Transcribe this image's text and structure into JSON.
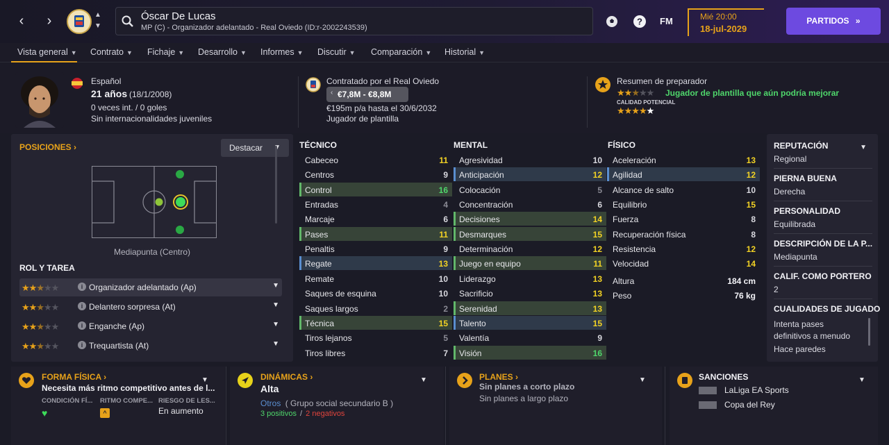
{
  "header": {
    "player_name": "Óscar De Lucas",
    "player_sub": "MP (C) - Organizador adelantado - Real Oviedo (ID:r-2002243539)",
    "date_day": "Mié 20:00",
    "date_value": "18-jul-2029",
    "fm_label": "FM",
    "continue_label": "PARTIDOS",
    "accent": "#e7a21a",
    "continue_color": "#6d4ae0"
  },
  "tabs": [
    {
      "label": "Vista general"
    },
    {
      "label": "Contrato"
    },
    {
      "label": "Fichaje"
    },
    {
      "label": "Desarrollo"
    },
    {
      "label": "Informes"
    },
    {
      "label": "Discutir"
    },
    {
      "label": "Comparación"
    },
    {
      "label": "Historial"
    }
  ],
  "profile": {
    "nationality": "Español",
    "age": "21 años",
    "birth": "(18/1/2008)",
    "caps": "0 veces int. / 0 goles",
    "youth_caps": "Sin internacionalidades juveniles",
    "contracted_by": "Contratado por el Real Oviedo",
    "value": "€7,8M - €8,8M",
    "wage": "€195m p/a hasta el 30/6/2032",
    "squad_status": "Jugador de plantilla",
    "coach_report_title": "Resumen de preparador",
    "coach_report_text": "Jugador de plantilla que aún podría mejorar",
    "current_ability_stars": 2.5,
    "potential_label": "CALIDAD POTENCIAL",
    "potential_stars": 4.5
  },
  "positions": {
    "title": "POSICIONES",
    "highlight_label": "Destacar",
    "position_label": "Mediapunta (Centro)"
  },
  "roles": {
    "title": "ROL Y TAREA",
    "items": [
      {
        "name": "Organizador adelantado (Ap)",
        "stars": 2.5
      },
      {
        "name": "Delantero sorpresa (At)",
        "stars": 2.5
      },
      {
        "name": "Enganche (Ap)",
        "stars": 2.5
      },
      {
        "name": "Trequartista (At)",
        "stars": 2.5
      }
    ]
  },
  "attributes": {
    "technical_title": "TÉCNICO",
    "mental_title": "MENTAL",
    "physical_title": "FÍSICO",
    "technical": [
      {
        "name": "Cabeceo",
        "value": "11",
        "hl": ""
      },
      {
        "name": "Centros",
        "value": "9",
        "hl": ""
      },
      {
        "name": "Control",
        "value": "16",
        "hl": "green"
      },
      {
        "name": "Entradas",
        "value": "4",
        "hl": ""
      },
      {
        "name": "Marcaje",
        "value": "6",
        "hl": ""
      },
      {
        "name": "Pases",
        "value": "11",
        "hl": "green"
      },
      {
        "name": "Penaltis",
        "value": "9",
        "hl": ""
      },
      {
        "name": "Regate",
        "value": "13",
        "hl": "blue"
      },
      {
        "name": "Remate",
        "value": "10",
        "hl": ""
      },
      {
        "name": "Saques de esquina",
        "value": "10",
        "hl": ""
      },
      {
        "name": "Saques largos",
        "value": "2",
        "hl": ""
      },
      {
        "name": "Técnica",
        "value": "15",
        "hl": "green"
      },
      {
        "name": "Tiros lejanos",
        "value": "5",
        "hl": ""
      },
      {
        "name": "Tiros libres",
        "value": "7",
        "hl": ""
      }
    ],
    "mental": [
      {
        "name": "Agresividad",
        "value": "10",
        "hl": ""
      },
      {
        "name": "Anticipación",
        "value": "12",
        "hl": "blue"
      },
      {
        "name": "Colocación",
        "value": "5",
        "hl": ""
      },
      {
        "name": "Concentración",
        "value": "6",
        "hl": ""
      },
      {
        "name": "Decisiones",
        "value": "14",
        "hl": "green"
      },
      {
        "name": "Desmarques",
        "value": "15",
        "hl": "green"
      },
      {
        "name": "Determinación",
        "value": "12",
        "hl": ""
      },
      {
        "name": "Juego en equipo",
        "value": "11",
        "hl": "green"
      },
      {
        "name": "Liderazgo",
        "value": "13",
        "hl": ""
      },
      {
        "name": "Sacrificio",
        "value": "13",
        "hl": ""
      },
      {
        "name": "Serenidad",
        "value": "13",
        "hl": "green"
      },
      {
        "name": "Talento",
        "value": "15",
        "hl": "blue"
      },
      {
        "name": "Valentía",
        "value": "9",
        "hl": ""
      },
      {
        "name": "Visión",
        "value": "16",
        "hl": "green"
      }
    ],
    "physical": [
      {
        "name": "Aceleración",
        "value": "13",
        "hl": ""
      },
      {
        "name": "Agilidad",
        "value": "12",
        "hl": "blue"
      },
      {
        "name": "Alcance de salto",
        "value": "10",
        "hl": ""
      },
      {
        "name": "Equilibrio",
        "value": "15",
        "hl": ""
      },
      {
        "name": "Fuerza",
        "value": "8",
        "hl": ""
      },
      {
        "name": "Recuperación física",
        "value": "8",
        "hl": ""
      },
      {
        "name": "Resistencia",
        "value": "12",
        "hl": ""
      },
      {
        "name": "Velocidad",
        "value": "14",
        "hl": ""
      }
    ],
    "height_label": "Altura",
    "height_value": "184 cm",
    "weight_label": "Peso",
    "weight_value": "76 kg"
  },
  "info": {
    "reputation_label": "REPUTACIÓN",
    "reputation_value": "Regional",
    "foot_label": "PIERNA BUENA",
    "foot_value": "Derecha",
    "personality_label": "PERSONALIDAD",
    "personality_value": "Equilibrada",
    "description_label": "DESCRIPCIÓN DE LA P...",
    "description_value": "Mediapunta",
    "gk_label": "CALIF. COMO PORTERO",
    "gk_value": "2",
    "traits_label": "CUALIDADES DE JUGADO",
    "traits": [
      "Intenta pases",
      "definitivos a menudo",
      "Hace paredes"
    ]
  },
  "cards": {
    "fitness": {
      "title": "FORMA FÍSICA",
      "text": "Necesita más ritmo competitivo antes de l...",
      "col1": "CONDICIÓN FÍ...",
      "col2": "RITMO COMPE...",
      "col3": "RIESGO DE LES...",
      "risk_value": "En aumento"
    },
    "dynamics": {
      "title": "DINÁMICAS",
      "level": "Alta",
      "group": "Otros",
      "group_desc": "( Grupo social secundario B )",
      "positives": "3 positivos",
      "negatives": "2 negativos"
    },
    "plans": {
      "title": "PLANES",
      "short": "Sin planes a corto plazo",
      "long": "Sin planes a largo plazo"
    },
    "sanctions": {
      "title": "SANCIONES",
      "comp1": "LaLiga EA Sports",
      "comp2": "Copa del Rey"
    }
  }
}
